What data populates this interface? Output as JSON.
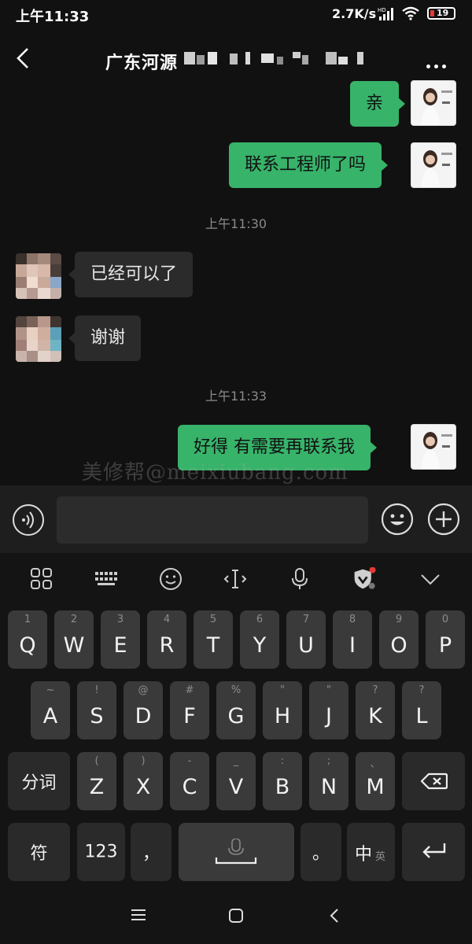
{
  "status_bar": {
    "time": "上午11:33",
    "speed": "2.7K/s",
    "battery": "19"
  },
  "chat": {
    "title": "广东河源",
    "messages": [
      {
        "from": "me",
        "text": "亲"
      },
      {
        "from": "me",
        "text": "联系工程师了吗"
      },
      {
        "timestamp": "上午11:30"
      },
      {
        "from": "other",
        "text": "已经可以了"
      },
      {
        "from": "other",
        "text": "谢谢"
      },
      {
        "timestamp": "上午11:33"
      },
      {
        "from": "me",
        "text": "好得 有需要再联系我"
      }
    ]
  },
  "watermark": "美修帮@meixiubang.com",
  "keyboard": {
    "row1": [
      {
        "main": "Q",
        "sub": "1"
      },
      {
        "main": "W",
        "sub": "2"
      },
      {
        "main": "E",
        "sub": "3"
      },
      {
        "main": "R",
        "sub": "4"
      },
      {
        "main": "T",
        "sub": "5"
      },
      {
        "main": "Y",
        "sub": "6"
      },
      {
        "main": "U",
        "sub": "7"
      },
      {
        "main": "I",
        "sub": "8"
      },
      {
        "main": "O",
        "sub": "9"
      },
      {
        "main": "P",
        "sub": "0"
      }
    ],
    "row2": [
      {
        "main": "A",
        "sub": "~"
      },
      {
        "main": "S",
        "sub": "!"
      },
      {
        "main": "D",
        "sub": "@"
      },
      {
        "main": "F",
        "sub": "#"
      },
      {
        "main": "G",
        "sub": "%"
      },
      {
        "main": "H",
        "sub": "\""
      },
      {
        "main": "J",
        "sub": "\""
      },
      {
        "main": "K",
        "sub": "?"
      },
      {
        "main": "L",
        "sub": "?"
      }
    ],
    "row3": [
      {
        "main": "Z",
        "sub": "("
      },
      {
        "main": "X",
        "sub": ")"
      },
      {
        "main": "C",
        "sub": "-"
      },
      {
        "main": "V",
        "sub": "_"
      },
      {
        "main": "B",
        "sub": ":"
      },
      {
        "main": "N",
        "sub": ";"
      },
      {
        "main": "M",
        "sub": "、"
      }
    ],
    "fenci": "分词",
    "symbol": "符",
    "num": "123",
    "comma": "，",
    "period": "。",
    "lang_main": "中",
    "lang_sub": "英"
  }
}
